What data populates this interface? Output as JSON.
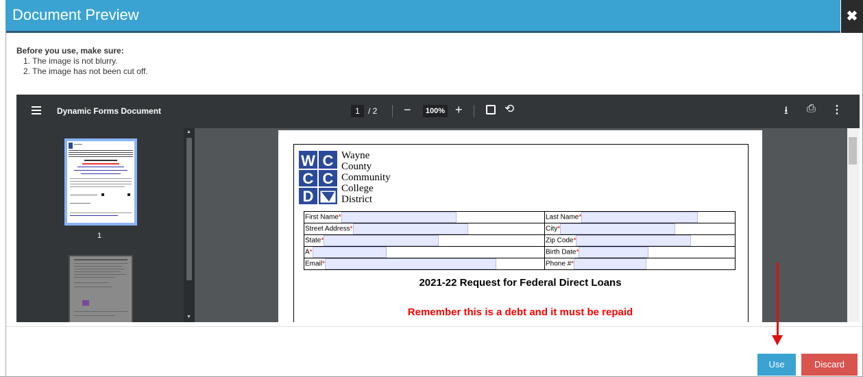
{
  "dialog": {
    "title": "Document Preview",
    "close_icon": "close-icon"
  },
  "instructions": {
    "lead": "Before you use, make sure:",
    "items": [
      "1. The image is not blurry.",
      "2. The image has not been cut off."
    ]
  },
  "viewer": {
    "toolbar": {
      "menu_icon": "menu-icon",
      "doc_title": "Dynamic Forms Document",
      "page_current": "1",
      "page_total": "/ 2",
      "zoom_out": "−",
      "zoom": "100%",
      "zoom_in": "+",
      "fit_icon": "fit-page-icon",
      "rotate_icon": "rotate-icon",
      "download_icon": "download-icon",
      "print_icon": "print-icon",
      "more_icon": "more-vert-icon"
    },
    "sidebar": {
      "thumbnails": [
        {
          "label": "1"
        }
      ]
    },
    "page": {
      "logo_lines": [
        "Wayne",
        "County",
        "Community",
        "College",
        "District"
      ],
      "form_rows": [
        {
          "left": "First Name",
          "right": "Last Name"
        },
        {
          "left": "Street Address",
          "right": "City"
        },
        {
          "left": "State",
          "right": "Zip Code"
        },
        {
          "left": "A",
          "right": "Birth Date"
        },
        {
          "left": "Email",
          "right": "Phone #"
        }
      ],
      "required_mark": "*",
      "heading": "2021-22 Request for Federal Direct Loans",
      "subheading": "Remember this is a debt and it must be repaid"
    }
  },
  "footer": {
    "use_label": "Use",
    "discard_label": "Discard"
  },
  "colors": {
    "header": "#3aa3d1",
    "use": "#3aa3d1",
    "discard": "#d9534f",
    "annotation_arrow": "#e01010"
  }
}
